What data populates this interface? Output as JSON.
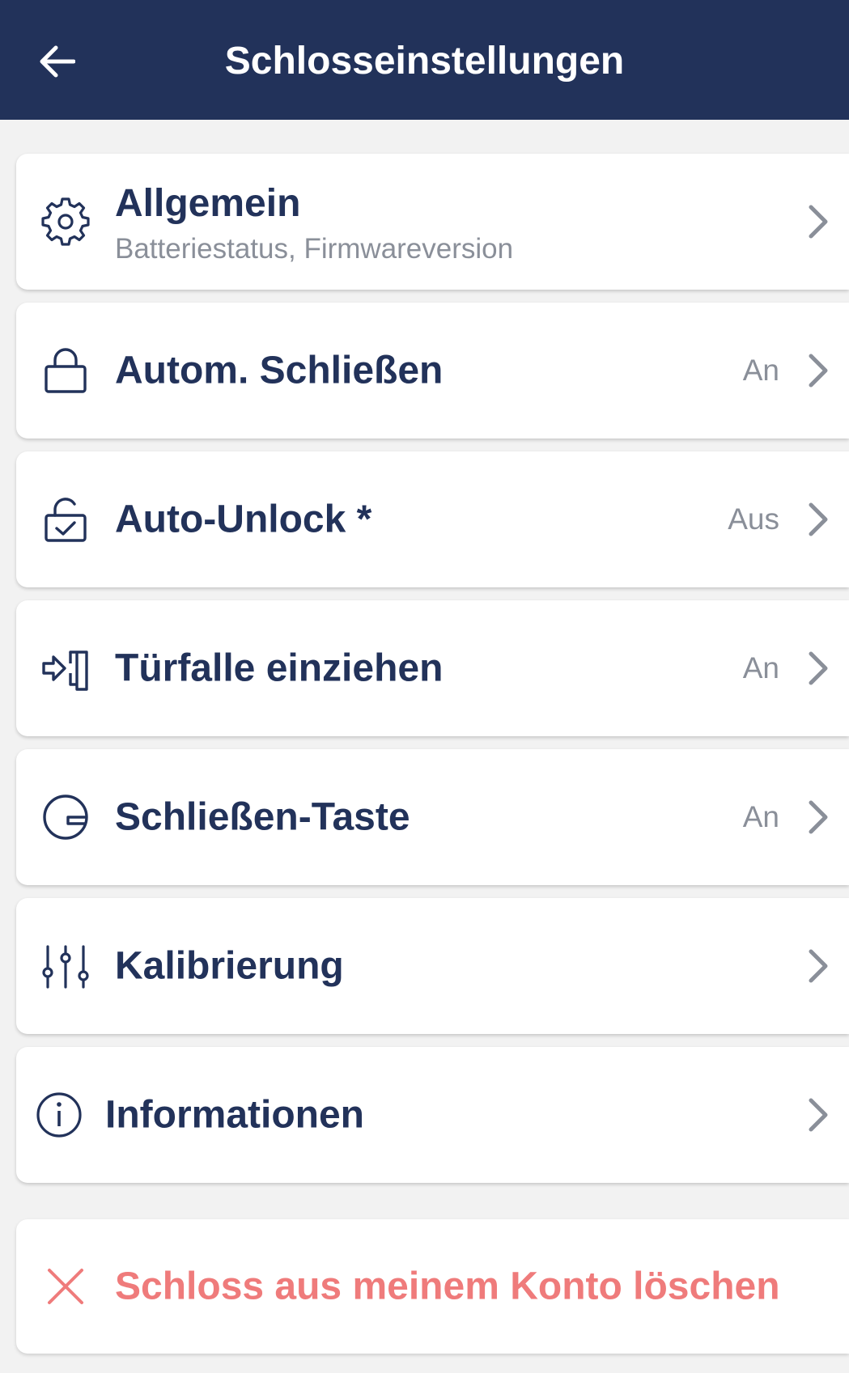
{
  "header": {
    "title": "Schlosseinstellungen",
    "back_icon": "arrow-left-icon"
  },
  "items": [
    {
      "label": "Allgemein",
      "subtitle": "Batteriestatus, Firmwareversion",
      "status": "",
      "icon": "gear-icon"
    },
    {
      "label": "Autom. Schließen",
      "status": "An",
      "icon": "lock-closed-icon"
    },
    {
      "label": "Auto-Unlock *",
      "status": "Aus",
      "icon": "lock-open-check-icon"
    },
    {
      "label": "Türfalle einziehen",
      "status": "An",
      "icon": "latch-pull-icon"
    },
    {
      "label": "Schließen-Taste",
      "status": "An",
      "icon": "lock-button-icon"
    },
    {
      "label": "Kalibrierung",
      "status": "",
      "icon": "sliders-icon"
    },
    {
      "label": "Informationen",
      "status": "",
      "icon": "info-icon"
    }
  ],
  "delete": {
    "label": "Schloss aus meinem Konto löschen",
    "icon": "close-icon"
  },
  "colors": {
    "header_bg": "#22325a",
    "text_primary": "#22325a",
    "text_secondary": "#8a8f99",
    "danger": "#ef7b7b",
    "background": "#f2f2f2"
  }
}
